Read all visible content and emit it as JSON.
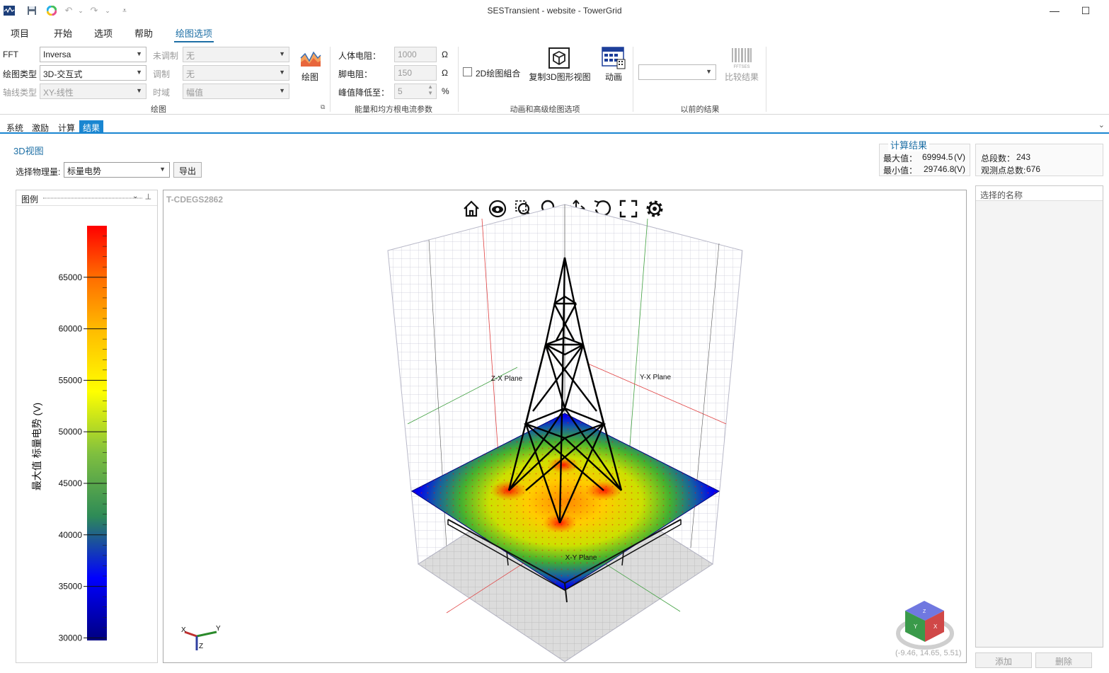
{
  "window": {
    "title": "SESTransient - website - TowerGrid",
    "minimize_glyph": "—",
    "maximize_glyph": "☐"
  },
  "menu": [
    "项目",
    "开始",
    "选项",
    "帮助",
    "绘图选项"
  ],
  "ribbon": {
    "plot_group": {
      "fft_label": "FFT",
      "fft_value": "Inversa",
      "plot_type_label": "绘图类型",
      "plot_type_value": "3D-交互式",
      "axis_type_label": "轴线类型",
      "axis_type_value": "XY-线性",
      "unmodulated_label": "未调制",
      "unmodulated_value": "无",
      "modulated_label": "调制",
      "modulated_value": "无",
      "time_domain_label": "时域",
      "time_domain_value": "幅值",
      "plot_button_label": "绘图",
      "group_label": "绘图",
      "launcher_glyph": "⧉"
    },
    "energy_group": {
      "body_resistance_label": "人体电阻：",
      "body_resistance_value": "1000",
      "foot_resistance_label": "脚电阻：",
      "foot_resistance_value": "150",
      "peak_reduction_label": "峰值降低至：",
      "peak_reduction_value": "5",
      "ohm_unit": "Ω",
      "percent_unit": "%",
      "group_label": "能量和均方根电流参数"
    },
    "animation_group": {
      "combine_2d_label": "2D绘图組合",
      "copy_3d_label": "复制3D图形视图",
      "animation_label": "动画",
      "group_label": "动画和高级绘图选项"
    },
    "previous_group": {
      "compare_label": "比较结果",
      "fftses_caption": "FFTSES",
      "group_label": "以前的结果"
    }
  },
  "doc_tabs": [
    "系统",
    "激励",
    "计算",
    "结果"
  ],
  "results": {
    "view_title": "3D视图",
    "quantity_label": "选择物理量:",
    "quantity_value": "标量电势",
    "export_label": "导出",
    "calc_title": "计算结果",
    "max_label": "最大值：",
    "max_value": "69994.5",
    "min_label": "最小值：",
    "min_value": "29746.8",
    "unit": "(V)",
    "segments_label": "总段数：",
    "segments_value": "243",
    "observation_label": "观测点总数:",
    "observation_value": "676"
  },
  "legend": {
    "title": "图例",
    "pin_glyph": "⊣",
    "axis_title": "最大值 标量电势 (V)",
    "ticks": [
      "65000",
      "60000",
      "55000",
      "50000",
      "45000",
      "40000",
      "35000",
      "30000"
    ],
    "colors": [
      "#ff0000",
      "#ff8c00",
      "#ffd700",
      "#ffff00",
      "#7fbf3f",
      "#2e8b57",
      "#0000ff",
      "#00008b"
    ]
  },
  "viewport": {
    "model_name": "T-CDEGS2862",
    "plane_zx": "Z-X Plane",
    "plane_yx": "Y-X Plane",
    "plane_xy": "X-Y Plane",
    "axis_x": "X",
    "axis_y": "Y",
    "axis_z": "Z",
    "coords": "(-9.46, 14.65, 5.51)",
    "cube_left": "Y",
    "cube_right": "X",
    "cube_top": "Z"
  },
  "right_panel": {
    "title": "选择的名称",
    "add_label": "添加",
    "delete_label": "删除"
  }
}
